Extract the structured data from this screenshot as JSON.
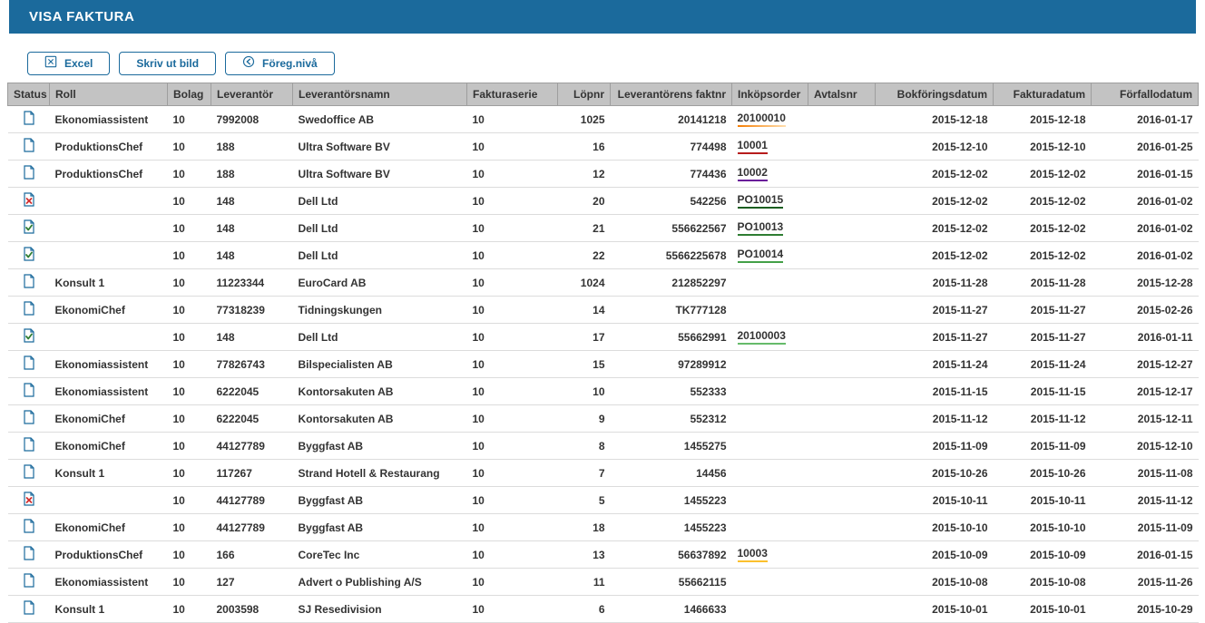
{
  "title": "VISA FAKTURA",
  "toolbar": {
    "excel": "Excel",
    "print": "Skriv ut bild",
    "back": "Föreg.nivå"
  },
  "columns": {
    "status": "Status",
    "roll": "Roll",
    "bolag": "Bolag",
    "lev": "Leverantör",
    "levnamn": "Leverantörsnamn",
    "serie": "Fakturaserie",
    "lopnr": "Löpnr",
    "lfaknr": "Leverantörens faktnr",
    "inkop": "Inköpsorder",
    "avtal": "Avtalsnr",
    "bok": "Bokföringsdatum",
    "fakd": "Fakturadatum",
    "forf": "Förfallodatum"
  },
  "rows": [
    {
      "status": "doc",
      "roll": "Ekonomiassistent",
      "bolag": "10",
      "lev": "7992008",
      "levnamn": "Swedoffice AB",
      "serie": "10",
      "lopnr": "1025",
      "lfaknr": "20141218",
      "inkop": "20100010",
      "inkop_accent": "po-orange",
      "avtal": "",
      "bok": "2015-12-18",
      "fakd": "2015-12-18",
      "forf": "2016-01-17"
    },
    {
      "status": "doc",
      "roll": "ProduktionsChef",
      "bolag": "10",
      "lev": "188",
      "levnamn": "Ultra Software BV",
      "serie": "10",
      "lopnr": "16",
      "lfaknr": "774498",
      "inkop": "10001",
      "inkop_accent": "po-red",
      "avtal": "",
      "bok": "2015-12-10",
      "fakd": "2015-12-10",
      "forf": "2016-01-25"
    },
    {
      "status": "doc",
      "roll": "ProduktionsChef",
      "bolag": "10",
      "lev": "188",
      "levnamn": "Ultra Software BV",
      "serie": "10",
      "lopnr": "12",
      "lfaknr": "774436",
      "inkop": "10002",
      "inkop_accent": "po-purple",
      "avtal": "",
      "bok": "2015-12-02",
      "fakd": "2015-12-02",
      "forf": "2016-01-15"
    },
    {
      "status": "err",
      "roll": "",
      "bolag": "10",
      "lev": "148",
      "levnamn": "Dell Ltd",
      "serie": "10",
      "lopnr": "20",
      "lfaknr": "542256",
      "inkop": "PO10015",
      "inkop_accent": "po-green1",
      "avtal": "",
      "bok": "2015-12-02",
      "fakd": "2015-12-02",
      "forf": "2016-01-02"
    },
    {
      "status": "ok",
      "roll": "",
      "bolag": "10",
      "lev": "148",
      "levnamn": "Dell Ltd",
      "serie": "10",
      "lopnr": "21",
      "lfaknr": "556622567",
      "inkop": "PO10013",
      "inkop_accent": "po-green2",
      "avtal": "",
      "bok": "2015-12-02",
      "fakd": "2015-12-02",
      "forf": "2016-01-02"
    },
    {
      "status": "ok",
      "roll": "",
      "bolag": "10",
      "lev": "148",
      "levnamn": "Dell Ltd",
      "serie": "10",
      "lopnr": "22",
      "lfaknr": "5566225678",
      "inkop": "PO10014",
      "inkop_accent": "po-green3",
      "avtal": "",
      "bok": "2015-12-02",
      "fakd": "2015-12-02",
      "forf": "2016-01-02"
    },
    {
      "status": "doc",
      "roll": "Konsult 1",
      "bolag": "10",
      "lev": "11223344",
      "levnamn": "EuroCard AB",
      "serie": "10",
      "lopnr": "1024",
      "lfaknr": "212852297",
      "inkop": "",
      "inkop_accent": "",
      "avtal": "",
      "bok": "2015-11-28",
      "fakd": "2015-11-28",
      "forf": "2015-12-28"
    },
    {
      "status": "doc",
      "roll": "EkonomiChef",
      "bolag": "10",
      "lev": "77318239",
      "levnamn": "Tidningskungen",
      "serie": "10",
      "lopnr": "14",
      "lfaknr": "TK777128",
      "inkop": "",
      "inkop_accent": "",
      "avtal": "",
      "bok": "2015-11-27",
      "fakd": "2015-11-27",
      "forf": "2015-02-26"
    },
    {
      "status": "ok",
      "roll": "",
      "bolag": "10",
      "lev": "148",
      "levnamn": "Dell Ltd",
      "serie": "10",
      "lopnr": "17",
      "lfaknr": "55662991",
      "inkop": "20100003",
      "inkop_accent": "po-green4",
      "avtal": "",
      "bok": "2015-11-27",
      "fakd": "2015-11-27",
      "forf": "2016-01-11"
    },
    {
      "status": "doc",
      "roll": "Ekonomiassistent",
      "bolag": "10",
      "lev": "77826743",
      "levnamn": "Bilspecialisten AB",
      "serie": "10",
      "lopnr": "15",
      "lfaknr": "97289912",
      "inkop": "",
      "inkop_accent": "",
      "avtal": "",
      "bok": "2015-11-24",
      "fakd": "2015-11-24",
      "forf": "2015-12-27"
    },
    {
      "status": "doc",
      "roll": "Ekonomiassistent",
      "bolag": "10",
      "lev": "6222045",
      "levnamn": "Kontorsakuten AB",
      "serie": "10",
      "lopnr": "10",
      "lfaknr": "552333",
      "inkop": "",
      "inkop_accent": "",
      "avtal": "",
      "bok": "2015-11-15",
      "fakd": "2015-11-15",
      "forf": "2015-12-17"
    },
    {
      "status": "doc",
      "roll": "EkonomiChef",
      "bolag": "10",
      "lev": "6222045",
      "levnamn": "Kontorsakuten AB",
      "serie": "10",
      "lopnr": "9",
      "lfaknr": "552312",
      "inkop": "",
      "inkop_accent": "",
      "avtal": "",
      "bok": "2015-11-12",
      "fakd": "2015-11-12",
      "forf": "2015-12-11"
    },
    {
      "status": "doc",
      "roll": "EkonomiChef",
      "bolag": "10",
      "lev": "44127789",
      "levnamn": "Byggfast AB",
      "serie": "10",
      "lopnr": "8",
      "lfaknr": "1455275",
      "inkop": "",
      "inkop_accent": "",
      "avtal": "",
      "bok": "2015-11-09",
      "fakd": "2015-11-09",
      "forf": "2015-12-10"
    },
    {
      "status": "doc",
      "roll": "Konsult 1",
      "bolag": "10",
      "lev": "117267",
      "levnamn": "Strand Hotell & Restaurang",
      "serie": "10",
      "lopnr": "7",
      "lfaknr": "14456",
      "inkop": "",
      "inkop_accent": "",
      "avtal": "",
      "bok": "2015-10-26",
      "fakd": "2015-10-26",
      "forf": "2015-11-08"
    },
    {
      "status": "err",
      "roll": "",
      "bolag": "10",
      "lev": "44127789",
      "levnamn": "Byggfast AB",
      "serie": "10",
      "lopnr": "5",
      "lfaknr": "1455223",
      "inkop": "",
      "inkop_accent": "",
      "avtal": "",
      "bok": "2015-10-11",
      "fakd": "2015-10-11",
      "forf": "2015-11-12"
    },
    {
      "status": "doc",
      "roll": "EkonomiChef",
      "bolag": "10",
      "lev": "44127789",
      "levnamn": "Byggfast AB",
      "serie": "10",
      "lopnr": "18",
      "lfaknr": "1455223",
      "inkop": "",
      "inkop_accent": "",
      "avtal": "",
      "bok": "2015-10-10",
      "fakd": "2015-10-10",
      "forf": "2015-11-09"
    },
    {
      "status": "doc",
      "roll": "ProduktionsChef",
      "bolag": "10",
      "lev": "166",
      "levnamn": "CoreTec Inc",
      "serie": "10",
      "lopnr": "13",
      "lfaknr": "56637892",
      "inkop": "10003",
      "inkop_accent": "po-yellow",
      "avtal": "",
      "bok": "2015-10-09",
      "fakd": "2015-10-09",
      "forf": "2016-01-15"
    },
    {
      "status": "doc",
      "roll": "Ekonomiassistent",
      "bolag": "10",
      "lev": "127",
      "levnamn": "Advert o Publishing A/S",
      "serie": "10",
      "lopnr": "11",
      "lfaknr": "55662115",
      "inkop": "",
      "inkop_accent": "",
      "avtal": "",
      "bok": "2015-10-08",
      "fakd": "2015-10-08",
      "forf": "2015-11-26"
    },
    {
      "status": "doc",
      "roll": "Konsult 1",
      "bolag": "10",
      "lev": "2003598",
      "levnamn": "SJ Resedivision",
      "serie": "10",
      "lopnr": "6",
      "lfaknr": "1466633",
      "inkop": "",
      "inkop_accent": "",
      "avtal": "",
      "bok": "2015-10-01",
      "fakd": "2015-10-01",
      "forf": "2015-10-29"
    }
  ]
}
